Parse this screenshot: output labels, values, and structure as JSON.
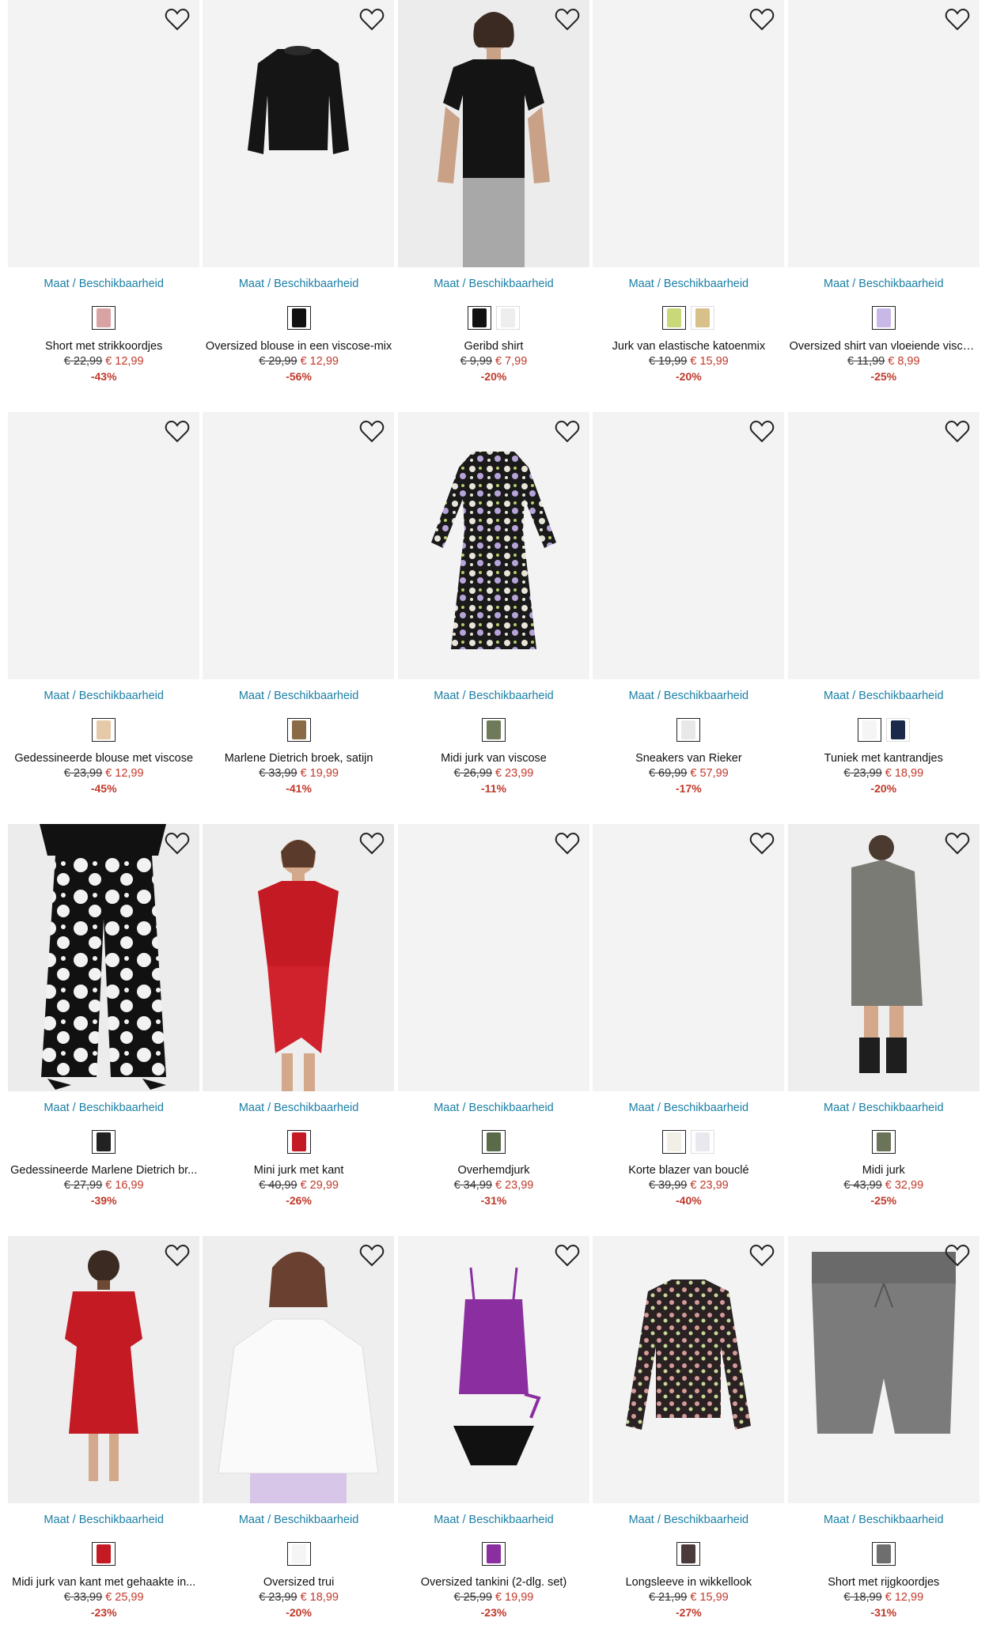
{
  "size_link_label": "Maat / Beschikbaarheid",
  "colors": {
    "link": "#1a7fa6",
    "price": "#c0392b",
    "image_bg": "#f3f3f3"
  },
  "products": [
    {
      "name": "Short met strikkoordjes",
      "old_price": "€ 22,99",
      "new_price": "€ 12,99",
      "discount": "-43%",
      "image": "none",
      "swatches": [
        "#d9a3a3"
      ]
    },
    {
      "name": "Oversized blouse in een viscose-mix",
      "old_price": "€ 29,99",
      "new_price": "€ 12,99",
      "discount": "-56%",
      "image": "black-blouse",
      "swatches": [
        "#111111"
      ]
    },
    {
      "name": "Geribd shirt",
      "old_price": "€ 9,99",
      "new_price": "€ 7,99",
      "discount": "-20%",
      "image": "model-black-top",
      "swatches": [
        "#111111",
        "#eeeeee"
      ]
    },
    {
      "name": "Jurk van elastische katoenmix",
      "old_price": "€ 19,99",
      "new_price": "€ 15,99",
      "discount": "-20%",
      "image": "none",
      "swatches": [
        "#c9d879",
        "#d8c08a"
      ]
    },
    {
      "name": "Oversized shirt van vloeiende viscose",
      "old_price": "€ 11,99",
      "new_price": "€ 8,99",
      "discount": "-25%",
      "image": "none",
      "swatches": [
        "#c8b8e8"
      ]
    },
    {
      "name": "Gedessineerde blouse met viscose",
      "old_price": "€ 23,99",
      "new_price": "€ 12,99",
      "discount": "-45%",
      "image": "none",
      "swatches": [
        "#e6c9a8"
      ]
    },
    {
      "name": "Marlene Dietrich broek, satijn",
      "old_price": "€ 33,99",
      "new_price": "€ 19,99",
      "discount": "-41%",
      "image": "none",
      "swatches": [
        "#8a6b45"
      ]
    },
    {
      "name": "Midi jurk van viscose",
      "old_price": "€ 26,99",
      "new_price": "€ 23,99",
      "discount": "-11%",
      "image": "floral-dress",
      "swatches": [
        "#6e7a5a"
      ]
    },
    {
      "name": "Sneakers van Rieker",
      "old_price": "€ 69,99",
      "new_price": "€ 57,99",
      "discount": "-17%",
      "image": "none",
      "swatches": [
        "#e8e8e8"
      ]
    },
    {
      "name": "Tuniek met kantrandjes",
      "old_price": "€ 23,99",
      "new_price": "€ 18,99",
      "discount": "-20%",
      "image": "none",
      "swatches": [
        "#f5f5f5",
        "#1b2a4a"
      ]
    },
    {
      "name": "Gedessineerde Marlene Dietrich br...",
      "old_price": "€ 27,99",
      "new_price": "€ 16,99",
      "discount": "-39%",
      "image": "model-floral-pants",
      "swatches": [
        "#222222"
      ]
    },
    {
      "name": "Mini jurk met kant",
      "old_price": "€ 40,99",
      "new_price": "€ 29,99",
      "discount": "-26%",
      "image": "model-red-dress",
      "swatches": [
        "#c41a24"
      ]
    },
    {
      "name": "Overhemdjurk",
      "old_price": "€ 34,99",
      "new_price": "€ 23,99",
      "discount": "-31%",
      "image": "none",
      "swatches": [
        "#5a6b4a"
      ]
    },
    {
      "name": "Korte blazer van bouclé",
      "old_price": "€ 39,99",
      "new_price": "€ 23,99",
      "discount": "-40%",
      "image": "none",
      "swatches": [
        "#f2efe6",
        "#e8e8ee"
      ]
    },
    {
      "name": "Midi jurk",
      "old_price": "€ 43,99",
      "new_price": "€ 32,99",
      "discount": "-25%",
      "image": "model-grey-dress",
      "swatches": [
        "#6b7358"
      ]
    },
    {
      "name": "Midi jurk van kant met gehaakte in...",
      "old_price": "€ 33,99",
      "new_price": "€ 25,99",
      "discount": "-23%",
      "image": "model-red-lace",
      "swatches": [
        "#c41a24"
      ]
    },
    {
      "name": "Oversized trui",
      "old_price": "€ 23,99",
      "new_price": "€ 18,99",
      "discount": "-20%",
      "image": "model-white-knit",
      "swatches": [
        "#f5f5f5"
      ]
    },
    {
      "name": "Oversized tankini (2-dlg. set)",
      "old_price": "€ 25,99",
      "new_price": "€ 19,99",
      "discount": "-23%",
      "image": "purple-tankini",
      "swatches": [
        "#8a2ea0"
      ]
    },
    {
      "name": "Longsleeve in wikkellook",
      "old_price": "€ 21,99",
      "new_price": "€ 15,99",
      "discount": "-27%",
      "image": "floral-blouse",
      "swatches": [
        "#4a3a3a"
      ]
    },
    {
      "name": "Short met rijgkoordjes",
      "old_price": "€ 18,99",
      "new_price": "€ 12,99",
      "discount": "-31%",
      "image": "grey-shorts",
      "swatches": [
        "#6e6e6e"
      ]
    }
  ]
}
